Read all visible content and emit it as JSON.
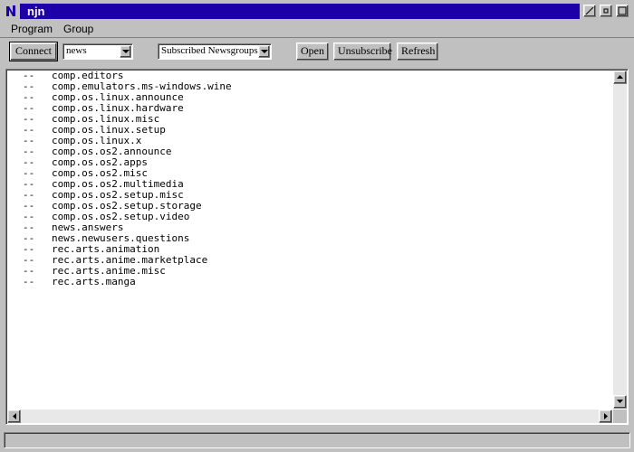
{
  "window": {
    "title": "njn",
    "controls": [
      "minimize-icon",
      "restore-icon",
      "maximize-icon"
    ]
  },
  "menu": {
    "items": [
      {
        "label": "Program"
      },
      {
        "label": "Group"
      }
    ]
  },
  "toolbar": {
    "connect_label": "Connect",
    "server_combo": {
      "value": "news"
    },
    "view_combo": {
      "value": "Subscribed Newsgroups"
    },
    "open_label": "Open",
    "unsubscribe_label": "Unsubscribe",
    "refresh_label": "Refresh"
  },
  "newsgroups": {
    "marker": "--",
    "items": [
      "comp.editors",
      "comp.emulators.ms-windows.wine",
      "comp.os.linux.announce",
      "comp.os.linux.hardware",
      "comp.os.linux.misc",
      "comp.os.linux.setup",
      "comp.os.linux.x",
      "comp.os.os2.announce",
      "comp.os.os2.apps",
      "comp.os.os2.misc",
      "comp.os.os2.multimedia",
      "comp.os.os2.setup.misc",
      "comp.os.os2.setup.storage",
      "comp.os.os2.setup.video",
      "news.answers",
      "news.newusers.questions",
      "rec.arts.animation",
      "rec.arts.anime.marketplace",
      "rec.arts.anime.misc",
      "rec.arts.manga"
    ]
  },
  "status": {
    "text": ""
  },
  "colors": {
    "titlebar": "#1e00a8",
    "face": "#c0c0c0",
    "list_bg": "#ffffff"
  }
}
